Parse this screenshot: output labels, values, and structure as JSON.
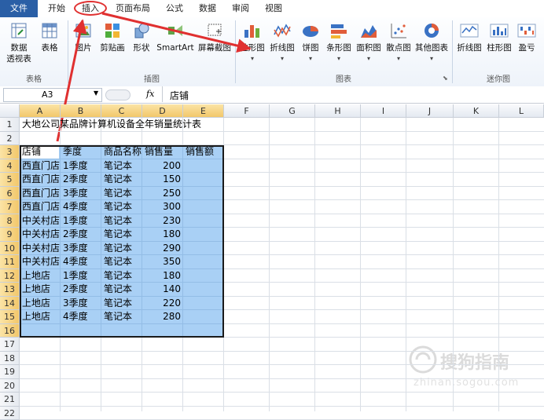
{
  "menu": {
    "file": "文件",
    "tabs": [
      "开始",
      "插入",
      "页面布局",
      "公式",
      "数据",
      "审阅",
      "视图"
    ]
  },
  "ribbon": {
    "tables_group": {
      "label": "表格",
      "pivot_label_1": "数据",
      "pivot_label_2": "透视表",
      "table_label": "表格"
    },
    "illustrations_group": {
      "label": "插图",
      "picture": "图片",
      "clipart": "剪贴画",
      "shapes": "形状",
      "smartart": "SmartArt",
      "screenshot": "屏幕截图"
    },
    "charts_group": {
      "label": "图表",
      "column": "柱形图",
      "line": "折线图",
      "pie": "饼图",
      "bar": "条形图",
      "area": "面积图",
      "scatter": "散点图",
      "other": "其他图表"
    },
    "sparklines_group": {
      "label": "迷你图",
      "line": "折线图",
      "column": "柱形图",
      "winloss": "盈亏"
    }
  },
  "formula_bar": {
    "name_box": "A3",
    "fx": "fx",
    "content": "店铺"
  },
  "columns": [
    "A",
    "B",
    "C",
    "D",
    "E",
    "F",
    "G",
    "H",
    "I",
    "J",
    "K",
    "L"
  ],
  "rows": [
    "1",
    "2",
    "3",
    "4",
    "5",
    "6",
    "7",
    "8",
    "9",
    "10",
    "11",
    "12",
    "13",
    "14",
    "15",
    "16",
    "17",
    "18",
    "19",
    "20",
    "21",
    "22"
  ],
  "sheet": {
    "title": "大地公司某品牌计算机设备全年销量统计表",
    "headers": [
      "店铺",
      "季度",
      "商品名称",
      "销售量",
      "销售额"
    ],
    "data": [
      [
        "西直门店",
        "1季度",
        "笔记本",
        "200",
        ""
      ],
      [
        "西直门店",
        "2季度",
        "笔记本",
        "150",
        ""
      ],
      [
        "西直门店",
        "3季度",
        "笔记本",
        "250",
        ""
      ],
      [
        "西直门店",
        "4季度",
        "笔记本",
        "300",
        ""
      ],
      [
        "中关村店",
        "1季度",
        "笔记本",
        "230",
        ""
      ],
      [
        "中关村店",
        "2季度",
        "笔记本",
        "180",
        ""
      ],
      [
        "中关村店",
        "3季度",
        "笔记本",
        "290",
        ""
      ],
      [
        "中关村店",
        "4季度",
        "笔记本",
        "350",
        ""
      ],
      [
        "上地店",
        "1季度",
        "笔记本",
        "180",
        ""
      ],
      [
        "上地店",
        "2季度",
        "笔记本",
        "140",
        ""
      ],
      [
        "上地店",
        "3季度",
        "笔记本",
        "220",
        ""
      ],
      [
        "上地店",
        "4季度",
        "笔记本",
        "280",
        ""
      ]
    ]
  },
  "watermark": {
    "text_cn": "搜狗指南",
    "text_url": "zhinan.sogou.com"
  },
  "colors": {
    "file_tab": "#2a5fa6",
    "selection": "#a9d0f5",
    "annotation": "#e03030"
  }
}
